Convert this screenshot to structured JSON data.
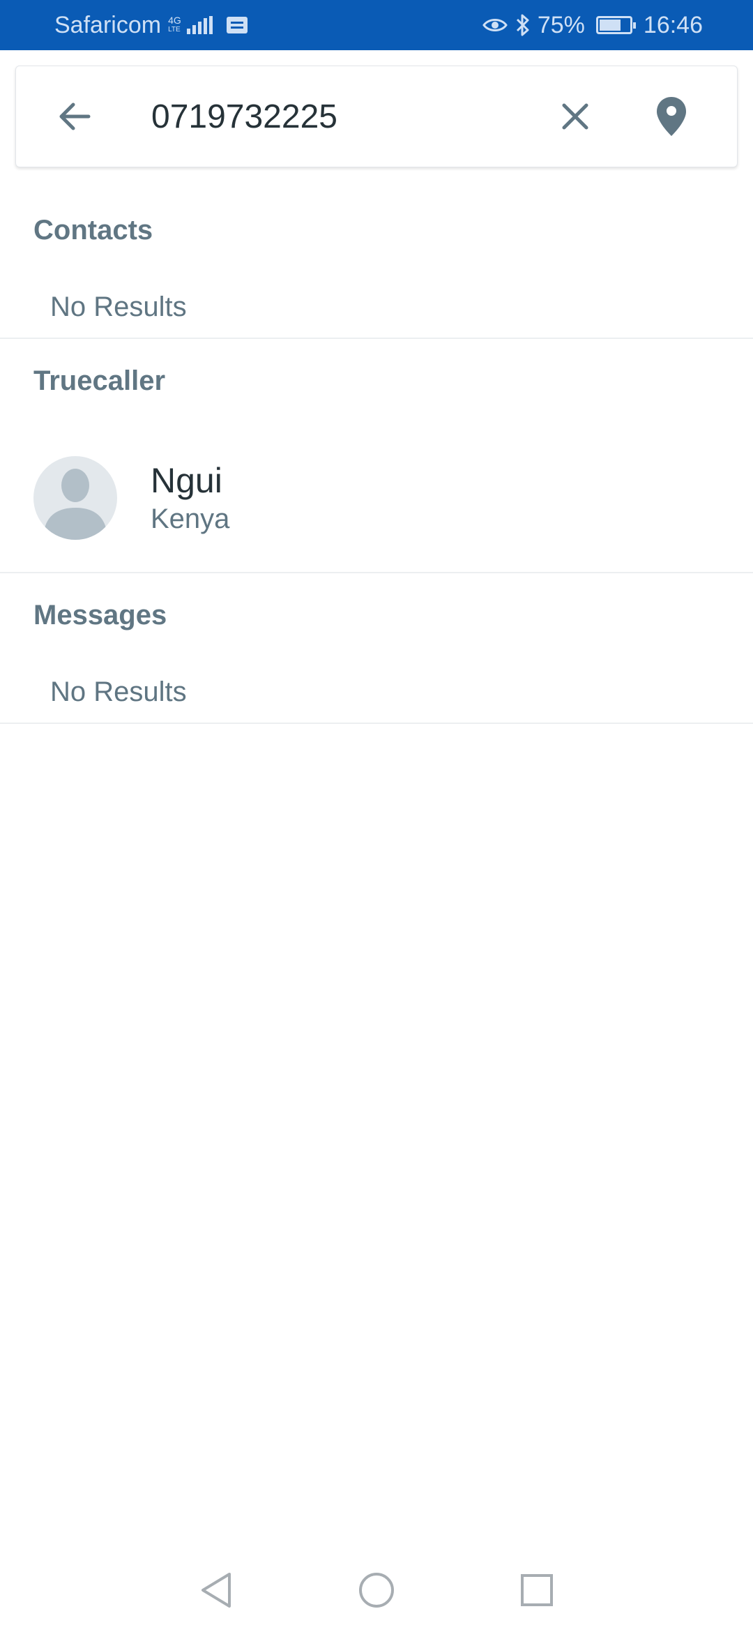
{
  "status_bar": {
    "carrier": "Safaricom",
    "network_top": "4G",
    "network_bottom": "LTE",
    "battery_percent": "75%",
    "battery_level": 0.75,
    "time": "16:46",
    "background_color": "#0a5bb5",
    "icons": [
      "signal-icon",
      "message-icon",
      "eye-comfort-icon",
      "bluetooth-icon",
      "battery-icon"
    ]
  },
  "search": {
    "back_icon": "arrow-left-icon",
    "query": "0719732225",
    "clear_icon": "close-icon",
    "location_icon": "location-pin-icon"
  },
  "sections": {
    "contacts": {
      "title": "Contacts",
      "empty_text": "No Results"
    },
    "truecaller": {
      "title": "Truecaller",
      "results": [
        {
          "name": "Ngui",
          "country": "Kenya",
          "avatar_icon": "person-placeholder-icon"
        }
      ]
    },
    "messages": {
      "title": "Messages",
      "empty_text": "No Results"
    }
  },
  "nav_bar": {
    "icons": [
      "back-triangle-icon",
      "home-circle-icon",
      "recents-square-icon"
    ]
  },
  "colors": {
    "accent": "#607683",
    "text_primary": "#263238",
    "text_secondary": "#5f7582",
    "divider": "#eceff1"
  }
}
